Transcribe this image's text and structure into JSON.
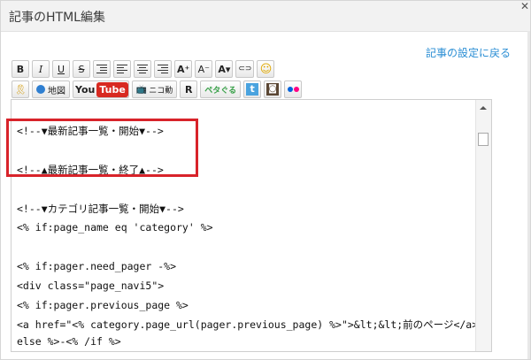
{
  "window": {
    "title": "記事のHTML編集"
  },
  "header": {
    "settings_link": "記事の設定に戻る"
  },
  "toolbar": {
    "row1": [
      {
        "name": "bold-button",
        "label": "B"
      },
      {
        "name": "italic-button",
        "label": "I"
      },
      {
        "name": "underline-button",
        "label": "U"
      },
      {
        "name": "strikethrough-button",
        "label": "S"
      },
      {
        "name": "indent-button",
        "label": "≡"
      },
      {
        "name": "align-left-button",
        "label": "≡"
      },
      {
        "name": "align-center-button",
        "label": "≡"
      },
      {
        "name": "align-right-button",
        "label": "≡"
      },
      {
        "name": "font-size-up-button",
        "label": "A⁺"
      },
      {
        "name": "font-size-down-button",
        "label": "A⁻"
      },
      {
        "name": "font-color-button",
        "label": "A▾"
      },
      {
        "name": "link-button",
        "label": "⊂⊃"
      },
      {
        "name": "emoji-button",
        "label": "☺"
      }
    ],
    "row2": {
      "badge": "🎗",
      "map_label": "地図",
      "youtube_you": "You",
      "youtube_tube": "Tube",
      "niconico_label": "ニコ動",
      "r_label": "R",
      "petagogu_label": "ペタぐる",
      "twitter_label": "t",
      "instagram_label": "◙",
      "flickr_label": "●●"
    }
  },
  "editor": {
    "lines": [
      "<!--▼最新記事一覧・開始▼-->",
      "",
      "<!--▲最新記事一覧・終了▲-->",
      "",
      "<!--▼カテゴリ記事一覧・開始▼-->",
      "<% if:page_name eq 'category' %>",
      "",
      "<% if:pager.need_pager -%>",
      "<div class=\"page_navi5\">",
      "<% if:pager.previous_page %>",
      "<a href=\"<% category.page_url(pager.previous_page) %>\">&lt;&lt;前のページ</a><%",
      "else %>-<% /if %>"
    ]
  },
  "colors": {
    "link": "#2a8ed4",
    "highlight_border": "#d8232a",
    "youtube_red": "#d82a21"
  }
}
